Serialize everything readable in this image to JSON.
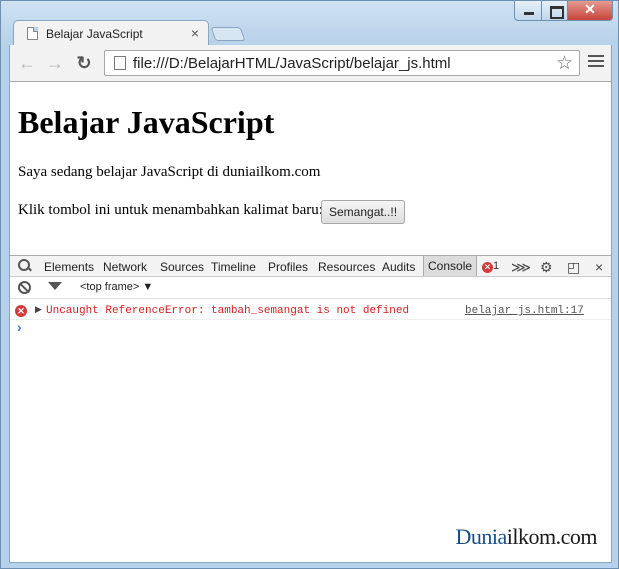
{
  "browser": {
    "tab_title": "Belajar JavaScript",
    "tab_close": "×",
    "url": "file:///D:/BelajarHTML/JavaScript/belajar_js.html",
    "back": "←",
    "forward": "→",
    "reload": "↻",
    "bookmark": "☆",
    "window_close": "✕"
  },
  "page": {
    "heading": "Belajar JavaScript",
    "paragraph": "Saya sedang belajar JavaScript di duniailkom.com",
    "prompt_text": "Klik tombol ini untuk menambahkan kalimat baru:",
    "button_label": "Semangat..!!"
  },
  "devtools": {
    "tabs": [
      "Elements",
      "Network",
      "Sources",
      "Timeline",
      "Profiles",
      "Resources",
      "Audits",
      "Console"
    ],
    "active_tab": "Console",
    "error_count": "1",
    "frame_selector": "<top frame>",
    "frame_arrow": "▼",
    "close": "×",
    "console": {
      "error_message": "Uncaught ReferenceError: tambah_semangat is not defined",
      "error_source": "belajar js.html:17",
      "prompt": "›"
    }
  },
  "watermark": {
    "part1": "Dunia",
    "part2": "ilkom.com"
  }
}
